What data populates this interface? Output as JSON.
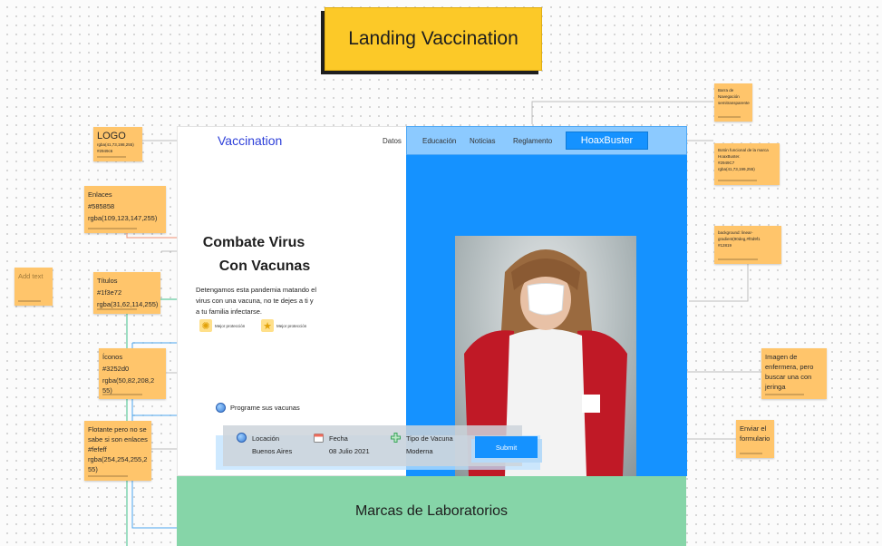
{
  "board": {
    "title": "Landing Vaccination"
  },
  "landing": {
    "logo": "Vaccination",
    "nav": [
      "Datos",
      "Educación",
      "Noticias",
      "Reglamento"
    ],
    "hoax_button": "HoaxBuster",
    "hero_title_line1": "Combate Virus",
    "hero_title_line2": "Con Vacunas",
    "hero_text": "Detengamos esta pandemia matando el virus con una vacuna, no te dejes a ti y a tu familia infectarse.",
    "features": [
      {
        "icon": "sun-badge-icon",
        "label": "Mejor protección"
      },
      {
        "icon": "star-badge-icon",
        "label": "Mejor protección"
      }
    ],
    "schedule_label": "Programe sus vacunas",
    "form": {
      "fields": [
        {
          "icon": "globe-icon",
          "label": "Locación",
          "value": "Buenos Aires"
        },
        {
          "icon": "calendar-icon",
          "label": "Fecha",
          "value": "08 Julio 2021"
        },
        {
          "icon": "plus-icon",
          "label": "Tipo de Vacuna",
          "value": "Moderna"
        }
      ],
      "submit_label": "Submit"
    },
    "hero_image_alt": "Mujer con mascarilla y abrigo rojo",
    "labs_title": "Marcas de Laboratorios"
  },
  "notes": {
    "logo": {
      "title": "LOGO",
      "lines": [
        "rgba(41,73,198,255)",
        "#2949c6"
      ]
    },
    "enlaces": {
      "lines": [
        "Enlaces",
        "#585858",
        "rgba(109,123,147,255)"
      ]
    },
    "add_text": {
      "lines": [
        "Add text"
      ]
    },
    "titulos": {
      "lines": [
        "Títulos",
        "#1f3e72",
        "rgba(31,62,114,255)"
      ]
    },
    "iconos": {
      "lines": [
        "Íconos",
        "#3252d0",
        "rgba(50,82,208,2",
        "55)"
      ]
    },
    "flotante": {
      "lines": [
        "Flotante pero no se",
        "sabe si son enlaces",
        "#fefeff",
        "rgba(254,254,255,2",
        "55)"
      ]
    },
    "barra": {
      "lines": [
        "Barra de",
        "Navegación",
        "semitransparente"
      ]
    },
    "boton": {
      "lines": [
        "Botón funcional de la marca",
        "HoaxBuster.",
        "#2949C7",
        "rgba(41,73,199,255)"
      ]
    },
    "background": {
      "lines": [
        "background: linear-",
        "gradient(90deg,#f0d9f1",
        "#12819"
      ]
    },
    "imagen": {
      "lines": [
        "Imagen de",
        "enfermera, pero",
        "buscar una con",
        "jeringa"
      ]
    },
    "enviar": {
      "lines": [
        "Enviar el",
        "formulario"
      ]
    }
  },
  "colors": {
    "accent_blue": "#1592ff",
    "nav_blue": "#8ccaff",
    "logo_blue": "#2d3fd9",
    "note_orange": "#ffc56b",
    "title_yellow": "#fcc928",
    "labs_green": "#86d5a8"
  }
}
